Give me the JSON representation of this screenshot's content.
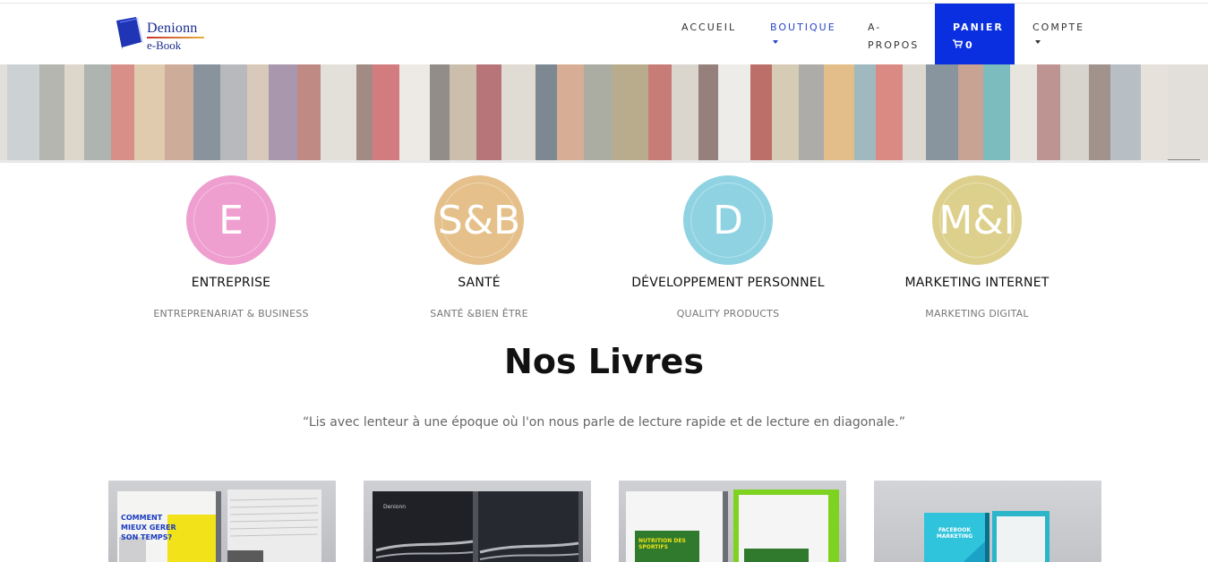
{
  "brand": {
    "name": "Denionn",
    "sub": "e-Book"
  },
  "nav": {
    "accueil": "ACCUEIL",
    "boutique": "BOUTIQUE",
    "apropos": "A-PROPOS",
    "panier": "PANIER",
    "panier_count": "0",
    "compte": "COMPTE"
  },
  "categories": [
    {
      "letter": "E",
      "title": "ENTREPRISE",
      "subtitle": "ENTREPRENARIAT & BUSINESS",
      "color": "#ef9fcf"
    },
    {
      "letter": "S&B",
      "title": "SANTÉ",
      "subtitle": "SANTÉ &BIEN ÊTRE",
      "color": "#e5c08a"
    },
    {
      "letter": "D",
      "title": "DÉVELOPPEMENT PERSONNEL",
      "subtitle": "QUALITY PRODUCTS",
      "color": "#8fd3e3"
    },
    {
      "letter": "M&I",
      "title": "MARKETING INTERNET",
      "subtitle": "MARKETING DIGITAL",
      "color": "#ddd08c"
    }
  ],
  "section": {
    "title": "Nos Livres",
    "quote": "“Lis avec lenteur à une époque où l'on nous parle de lecture rapide et de lecture en diagonale.”"
  },
  "products": [
    {
      "cover_text": "COMMENT MIEUX GERER SON TEMPS?"
    },
    {
      "cover_text": "Denionn"
    },
    {
      "cover_text": "NUTRITION DES SPORTIFS"
    },
    {
      "cover_text": "FACEBOOK MARKETING"
    }
  ],
  "icons": {
    "cart": "cart-icon",
    "caret": "caret-down-icon"
  },
  "colors": {
    "accent": "#0a2fe0",
    "active_nav": "#2a45c8"
  }
}
